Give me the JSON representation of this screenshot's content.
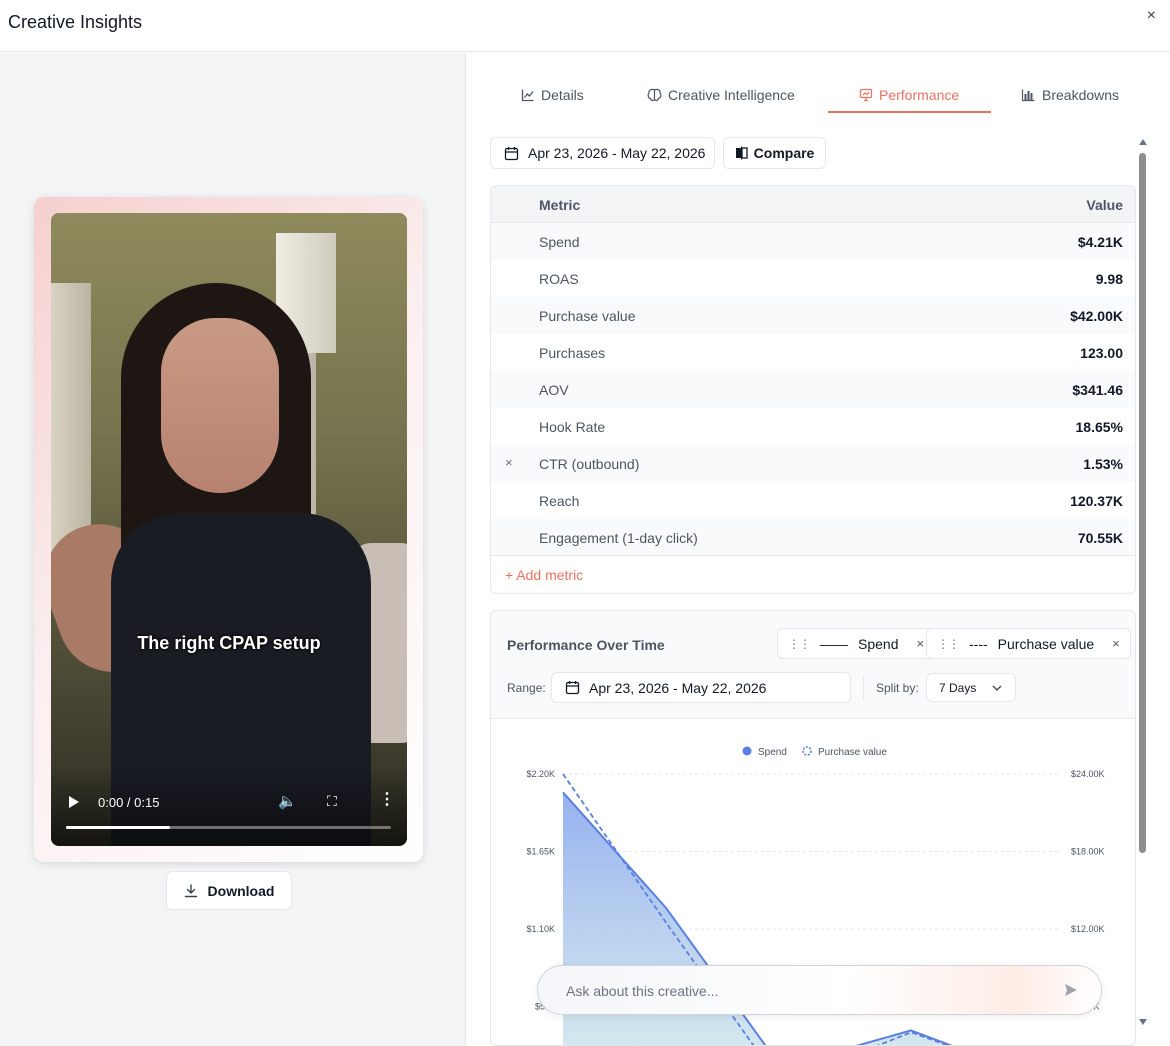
{
  "header": {
    "title": "Creative Insights",
    "close_icon": "×"
  },
  "video": {
    "caption": "The right CPAP setup",
    "time": "0:00 / 0:15",
    "progress_fraction": 0.32
  },
  "download": {
    "label": "Download"
  },
  "tabs": [
    {
      "label": "Details",
      "icon": "line-chart-icon"
    },
    {
      "label": "Creative Intelligence",
      "icon": "brain-icon"
    },
    {
      "label": "Performance",
      "icon": "presentation-chart-icon",
      "active": true
    },
    {
      "label": "Breakdowns",
      "icon": "bar-chart-icon"
    }
  ],
  "toolbar": {
    "date_range": "Apr 23, 2026 - May 22, 2026",
    "compare_label": "Compare"
  },
  "metrics": {
    "col_metric": "Metric",
    "col_value": "Value",
    "rows": [
      {
        "name": "Spend",
        "value": "$4.21K"
      },
      {
        "name": "ROAS",
        "value": "9.98"
      },
      {
        "name": "Purchase value",
        "value": "$42.00K"
      },
      {
        "name": "Purchases",
        "value": "123.00"
      },
      {
        "name": "AOV",
        "value": "$341.46"
      },
      {
        "name": "Hook Rate",
        "value": "18.65%"
      },
      {
        "name": "CTR (outbound)",
        "value": "1.53%",
        "remove": "×"
      },
      {
        "name": "Reach",
        "value": "120.37K"
      },
      {
        "name": "Engagement (1-day click)",
        "value": "70.55K"
      }
    ],
    "add_label": "+ Add metric"
  },
  "performance": {
    "title": "Performance Over Time",
    "pills": [
      {
        "label": "Spend",
        "line": "——"
      },
      {
        "label": "Purchase value",
        "line": "----"
      }
    ],
    "pill_remove": "×",
    "range_label": "Range:",
    "range_value": "Apr 23, 2026 - May 22, 2026",
    "split_label": "Split by:",
    "split_value": "7 Days"
  },
  "chart_data": {
    "type": "line",
    "legend": [
      "Spend",
      "Purchase value"
    ],
    "y_left_ticks": [
      "$2.20K",
      "$1.65K",
      "$1.10K",
      "$550"
    ],
    "y_right_ticks": [
      "$24.00K",
      "$18.00K",
      "$12.00K",
      "$6.00K"
    ],
    "series": [
      {
        "name": "Spend",
        "axis": "left",
        "values": [
          2070,
          1250,
          120,
          380,
          60
        ],
        "color": "#5b7fe0"
      },
      {
        "name": "Purchase value",
        "axis": "right",
        "values": [
          24000,
          12500,
          0,
          4000,
          700
        ],
        "color": "#5b7fe0"
      }
    ],
    "colors": {
      "accent": "#e8735f",
      "series": "#5b7fe0"
    }
  },
  "ask": {
    "placeholder": "Ask about this creative..."
  }
}
